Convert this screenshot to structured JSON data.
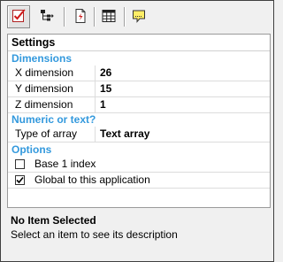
{
  "toolbar": {
    "buttons": [
      {
        "icon": "checklist-icon",
        "pressed": true
      },
      {
        "icon": "tree-hierarchy-icon",
        "pressed": false
      },
      {
        "icon": "document-lightning-icon",
        "pressed": false
      },
      {
        "icon": "table-grid-icon",
        "pressed": false
      },
      {
        "icon": "note-icon",
        "pressed": false
      }
    ]
  },
  "grid": {
    "header": "Settings",
    "dimensions": {
      "title": "Dimensions",
      "x": {
        "name": "X dimension",
        "value": "26"
      },
      "y": {
        "name": "Y dimension",
        "value": "15"
      },
      "z": {
        "name": "Z dimension",
        "value": "1"
      }
    },
    "numeric": {
      "title": "Numeric or text?",
      "type": {
        "name": "Type of array",
        "value": "Text array"
      }
    },
    "options": {
      "title": "Options",
      "base1": {
        "label": "Base 1 index",
        "checked": false
      },
      "global": {
        "label": "Global to this application",
        "checked": true
      }
    }
  },
  "description": {
    "title": "No Item Selected",
    "text": "Select an item to see its description"
  },
  "colors": {
    "category": "#3399dd",
    "window_bg": "#f0f0f0"
  }
}
